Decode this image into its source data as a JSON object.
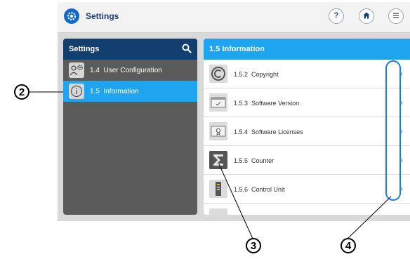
{
  "header": {
    "title": "Settings",
    "help_label": "?",
    "home_icon": "home-icon",
    "menu_icon": "menu-icon"
  },
  "left_panel": {
    "title": "Settings",
    "items": [
      {
        "number": "1.4",
        "label": "User Configuration",
        "icon": "user-gear-icon",
        "active": false
      },
      {
        "number": "1.5",
        "label": "Information",
        "icon": "info-icon",
        "active": true
      }
    ]
  },
  "right_panel": {
    "title": "1.5 Information",
    "items": [
      {
        "number": "1.5.2",
        "label": "Copyright",
        "icon": "copyright-icon"
      },
      {
        "number": "1.5.3",
        "label": "Software Version",
        "icon": "software-version-icon"
      },
      {
        "number": "1.5.4",
        "label": "Software Licenses",
        "icon": "license-certificate-icon"
      },
      {
        "number": "1.5.5",
        "label": "Counter",
        "icon": "sigma-counter-icon"
      },
      {
        "number": "1.5.6",
        "label": "Control Unit",
        "icon": "control-unit-icon"
      }
    ]
  },
  "callouts": {
    "c2": "2",
    "c3": "3",
    "c4": "4"
  },
  "colors": {
    "header_dark": "#123f6e",
    "accent_blue": "#1fa4f0",
    "panel_gray": "#5b5b5b",
    "highlight_blue": "#1e7fd6"
  }
}
